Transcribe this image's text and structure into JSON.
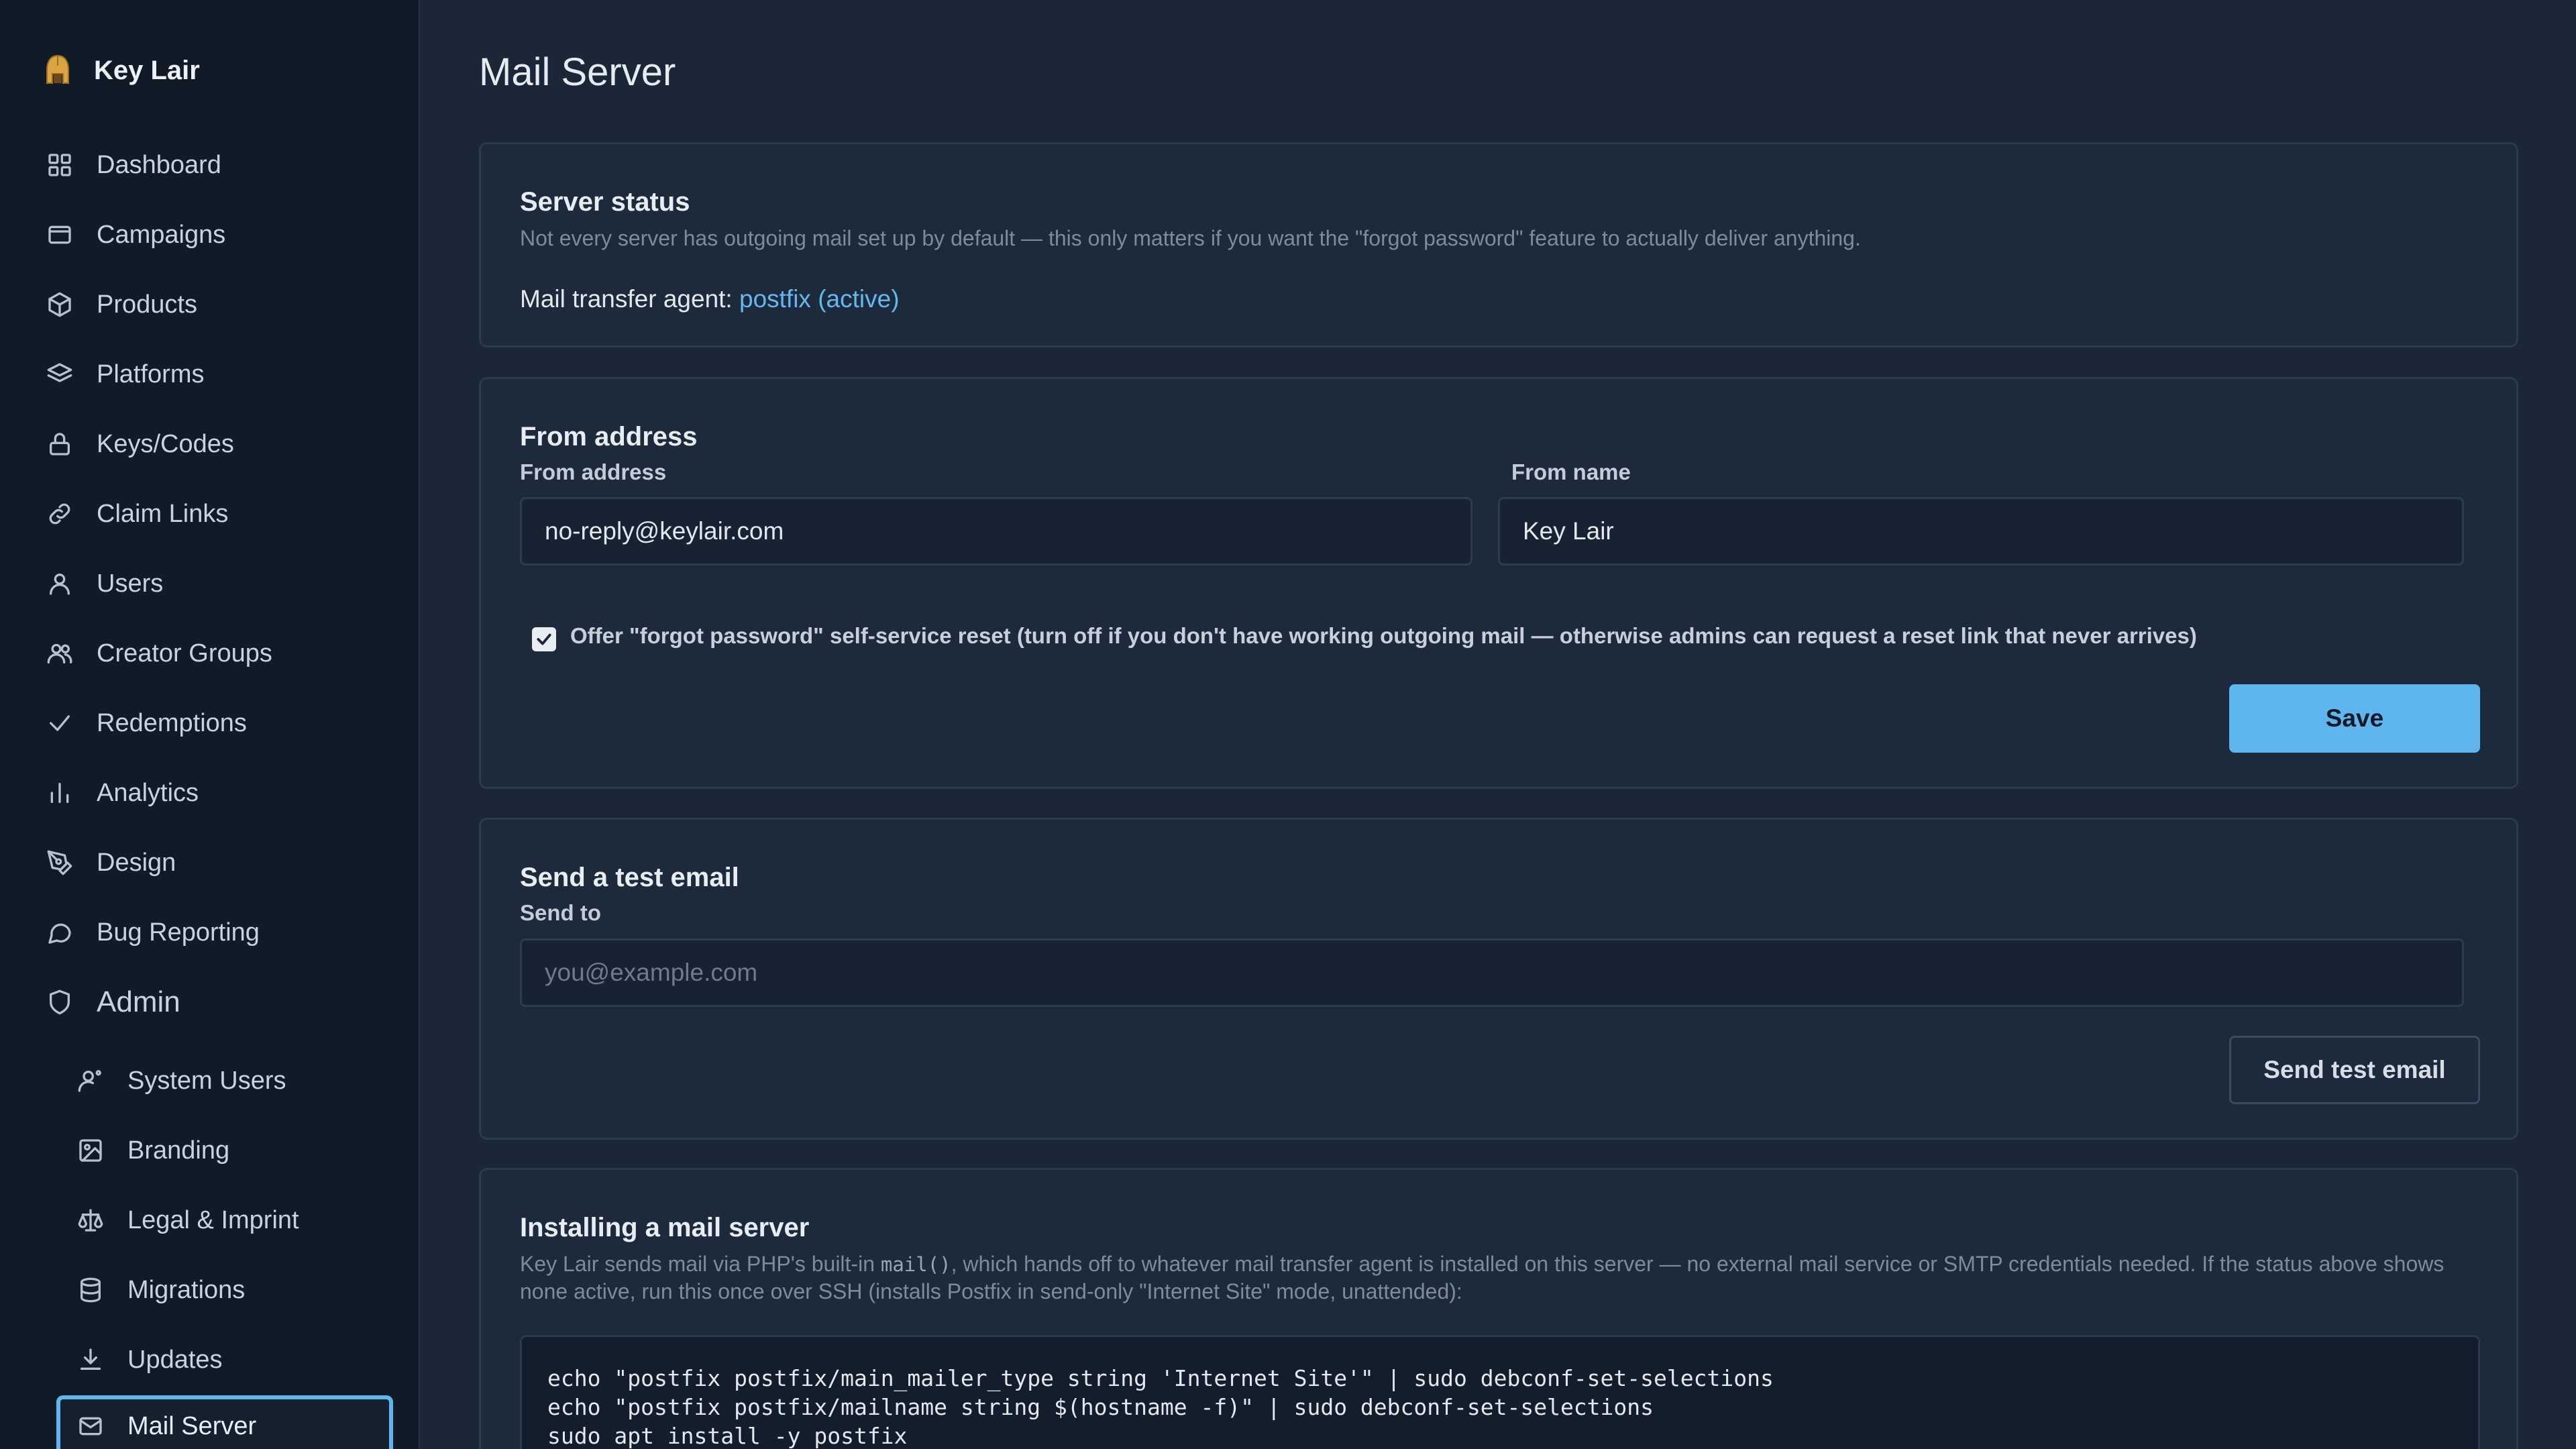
{
  "brand": {
    "name": "Key Lair",
    "logo_icon": "helmet-icon"
  },
  "nav": {
    "items": [
      {
        "label": "Dashboard",
        "icon": "grid-icon"
      },
      {
        "label": "Campaigns",
        "icon": "window-icon"
      },
      {
        "label": "Products",
        "icon": "box-icon"
      },
      {
        "label": "Platforms",
        "icon": "layers-icon"
      },
      {
        "label": "Keys/Codes",
        "icon": "lock-icon"
      },
      {
        "label": "Claim Links",
        "icon": "link-icon"
      },
      {
        "label": "Users",
        "icon": "user-icon"
      },
      {
        "label": "Creator Groups",
        "icon": "users-icon"
      },
      {
        "label": "Redemptions",
        "icon": "check-icon"
      },
      {
        "label": "Analytics",
        "icon": "bar-chart-icon"
      },
      {
        "label": "Design",
        "icon": "pen-tool-icon"
      },
      {
        "label": "Bug Reporting",
        "icon": "chat-bubble-icon"
      }
    ],
    "admin_section": {
      "label": "Admin",
      "icon": "shield-icon"
    },
    "admin_items": [
      {
        "label": "System Users",
        "icon": "user-cog-icon"
      },
      {
        "label": "Branding",
        "icon": "image-icon"
      },
      {
        "label": "Legal & Imprint",
        "icon": "scale-icon"
      },
      {
        "label": "Migrations",
        "icon": "database-icon"
      },
      {
        "label": "Updates",
        "icon": "download-icon"
      },
      {
        "label": "Mail Server",
        "icon": "mail-icon",
        "active": true
      }
    ]
  },
  "page": {
    "title": "Mail Server"
  },
  "server_status": {
    "heading": "Server status",
    "description": "Not every server has outgoing mail set up by default — this only matters if you want the \"forgot password\" feature to actually deliver anything.",
    "mta_label": "Mail transfer agent:",
    "mta_value": "postfix (active)"
  },
  "from_address": {
    "heading": "From address",
    "address_label": "From address",
    "address_value": "no-reply@keylair.com",
    "name_label": "From name",
    "name_value": "Key Lair",
    "checkbox_checked": true,
    "checkbox_label": "Offer \"forgot password\" self-service reset (turn off if you don't have working outgoing mail — otherwise admins can request a reset link that never arrives)",
    "save_label": "Save"
  },
  "test_email": {
    "heading": "Send a test email",
    "send_to_label": "Send to",
    "send_to_placeholder": "you@example.com",
    "button_label": "Send test email"
  },
  "install": {
    "heading": "Installing a mail server",
    "desc_part1": "Key Lair sends mail via PHP's built-in ",
    "desc_code": "mail()",
    "desc_part2": ", which hands off to whatever mail transfer agent is installed on this server — no external mail service or SMTP credentials needed. If the status above shows none active, run this once over SSH (installs Postfix in send-only \"Internet Site\" mode, unattended):",
    "code_lines": [
      "echo \"postfix postfix/main_mailer_type string 'Internet Site'\" | sudo debconf-set-selections",
      "echo \"postfix postfix/mailname string $(hostname -f)\" | sudo debconf-set-selections",
      "sudo apt install -y postfix"
    ]
  },
  "colors": {
    "accent": "#5fb6ee",
    "background": "#1b2637",
    "sidebar": "#111a27"
  }
}
